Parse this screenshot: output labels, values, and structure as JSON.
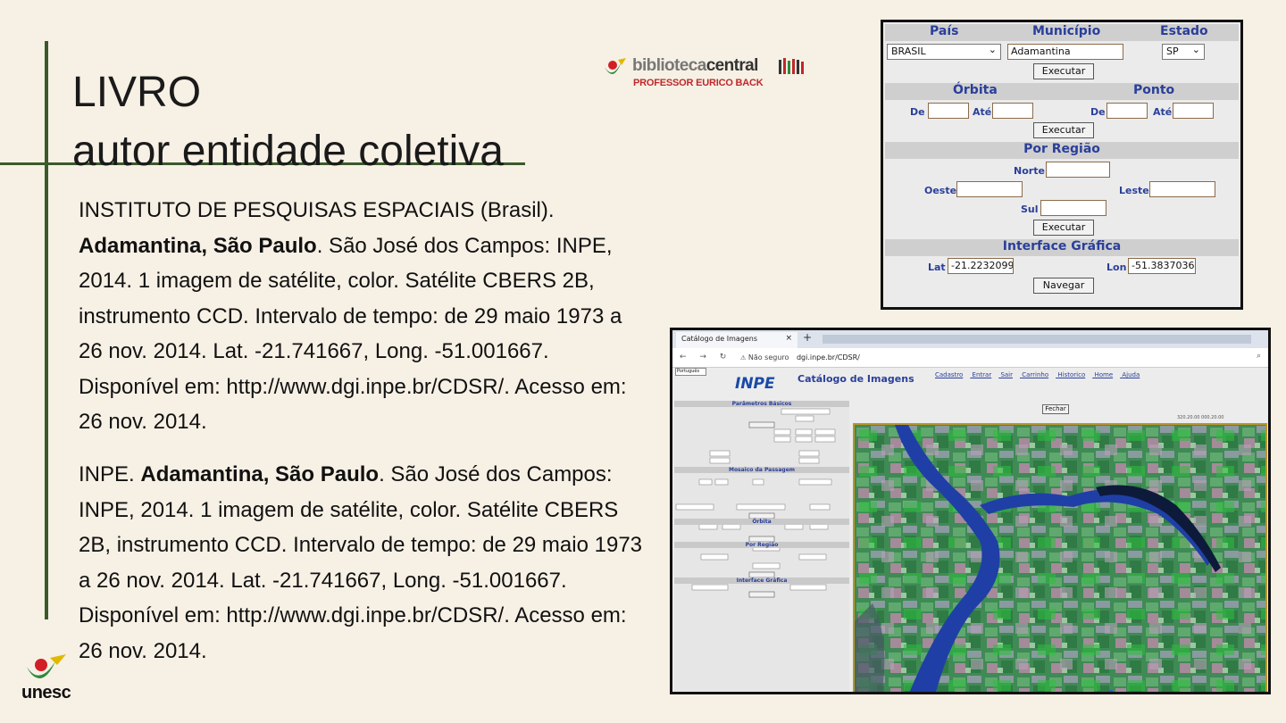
{
  "slide": {
    "title_line1": "LIVRO",
    "title_line2": "autor entidade coletiva",
    "logos": {
      "biblioteca_main_light": "biblioteca",
      "biblioteca_main_bold": "central",
      "biblioteca_sub": "PROFESSOR EURICO BACK",
      "unesc": "unesc"
    },
    "reference1": {
      "author": "INSTITUTO DE PESQUISAS ESPACIAIS (Brasil).",
      "title": "Adamantina, São Paulo",
      "rest": ". São José dos Campos: INPE, 2014. 1 imagem de satélite, color. Satélite CBERS 2B, instrumento CCD. Intervalo de tempo: de 29 maio 1973 a 26 nov. 2014. Lat. -21.741667, Long. -51.001667. Disponível em: http://www.dgi.inpe.br/CDSR/. Acesso em: 26 nov. 2014."
    },
    "reference2": {
      "author": "INPE. ",
      "title": "Adamantina, São Paulo",
      "rest": ". São José dos Campos: INPE, 2014. 1 imagem de satélite, color. Satélite CBERS 2B, instrumento CCD. Intervalo de tempo: de 29 maio 1973 a 26 nov. 2014. Lat. -21.741667, Long. -51.001667. Disponível em: http://www.dgi.inpe.br/CDSR/. Acesso em: 26 nov. 2014."
    }
  },
  "form_panel": {
    "headers": {
      "pais": "País",
      "municipio": "Município",
      "estado": "Estado",
      "orbita": "Órbita",
      "ponto": "Ponto",
      "por_regiao": "Por Região",
      "interface_grafica": "Interface Gráfica"
    },
    "pais_value": "BRASIL",
    "municipio_value": "Adamantina",
    "estado_value": "SP",
    "de": "De",
    "ate": "Até",
    "norte": "Norte",
    "oeste": "Oeste",
    "leste": "Leste",
    "sul": "Sul",
    "lat_label": "Lat",
    "lat_value": "-21.2232099",
    "lon_label": "Lon",
    "lon_value": "-51.3837036",
    "executar": "Executar",
    "navegar": "Navegar"
  },
  "browser": {
    "tab_title": "Catálogo de Imagens",
    "tab_close": "×",
    "new_tab": "+",
    "not_secure": "Não seguro",
    "url": "dgi.inpe.br/CDSR/",
    "lang": "Português",
    "logo": "INPE",
    "page_title": "Catálogo de Imagens",
    "menu": [
      "Cadastro",
      "Entrar",
      "Sair",
      "Carrinho",
      "Historico",
      "Home",
      "Ajuda"
    ],
    "left_headers": [
      "Parâmetros Básicos",
      "Mosaico da Passagem",
      "Órbita",
      "Por Região",
      "Interface Gráfica"
    ],
    "fechar": "Fechar",
    "coords": "320.20.00 000.20.00"
  }
}
